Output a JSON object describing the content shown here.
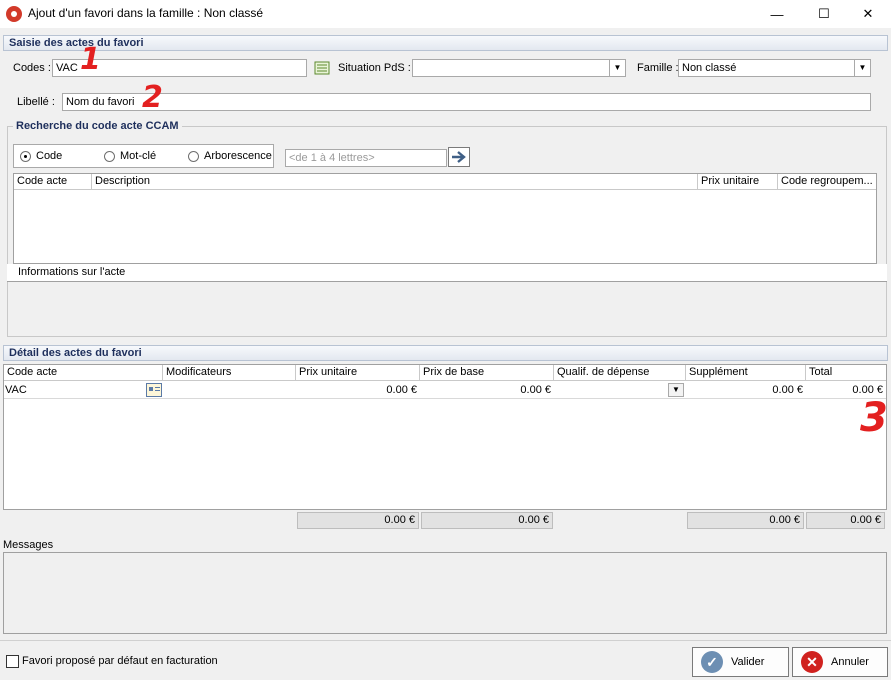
{
  "window": {
    "title": "Ajout d'un favori dans la famille : Non classé",
    "minimize_glyph": "—",
    "maximize_glyph": "☐",
    "close_glyph": "✕"
  },
  "saisie": {
    "header": "Saisie des actes du favori",
    "codes_label": "Codes :",
    "codes_value": "VAC",
    "situation_label": "Situation PdS :",
    "situation_value": "",
    "famille_label": "Famille :",
    "famille_value": "Non classé",
    "libelle_label": "Libellé :",
    "libelle_value": "Nom du favori"
  },
  "recherche": {
    "title": "Recherche du code acte CCAM",
    "radios": [
      {
        "label": "Code",
        "selected": true
      },
      {
        "label": "Mot-clé",
        "selected": false
      },
      {
        "label": "Arborescence",
        "selected": false
      }
    ],
    "search_placeholder": "<de 1 à 4 lettres>",
    "columns": [
      "Code acte",
      "Description",
      "Prix unitaire",
      "Code regroupem..."
    ],
    "info_label": "Informations sur l'acte"
  },
  "detail": {
    "header": "Détail des actes du favori",
    "columns": [
      "Code acte",
      "Modificateurs",
      "Prix unitaire",
      "Prix de base",
      "Qualif. de dépense",
      "Supplément",
      "Total"
    ],
    "rows": [
      {
        "code": "VAC",
        "modificateurs": "",
        "prix_unitaire": "0.00 €",
        "prix_base": "0.00 €",
        "qualif": "",
        "supplement": "0.00 €",
        "total": "0.00 €"
      }
    ],
    "totals": {
      "prix_unitaire": "0.00 €",
      "prix_base": "0.00 €",
      "supplement": "0.00 €",
      "total": "0.00 €"
    }
  },
  "messages": {
    "label": "Messages"
  },
  "footer": {
    "checkbox_label": "Favori proposé par défaut en facturation",
    "valider_label": "Valider",
    "annuler_label": "Annuler"
  },
  "annotations": [
    "1",
    "2",
    "3"
  ],
  "colors": {
    "section_header_text": "#1e2f5c",
    "annotation": "#e32020",
    "valider_icon": "#6d8fb3",
    "annuler_icon": "#d0221f"
  }
}
